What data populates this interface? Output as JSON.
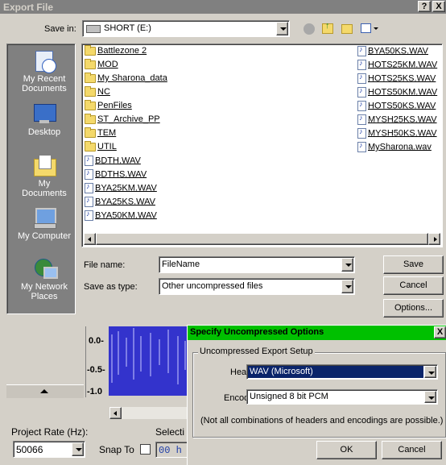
{
  "export_dialog": {
    "title": "Export File",
    "title_buttons": {
      "help": "?",
      "close": "X"
    },
    "save_in_label": "Save in:",
    "save_in_value": "SHORT (E:)",
    "places": [
      {
        "label": "My Recent Documents"
      },
      {
        "label": "Desktop"
      },
      {
        "label": "My Documents"
      },
      {
        "label": "My Computer"
      },
      {
        "label": "My Network Places"
      }
    ],
    "files_col1": [
      {
        "name": "Battlezone 2",
        "icon": "folder-icon"
      },
      {
        "name": "MOD",
        "icon": "folder-icon"
      },
      {
        "name": "My Sharona_data",
        "icon": "folder-icon"
      },
      {
        "name": "NC",
        "icon": "folder-icon"
      },
      {
        "name": "PenFiles",
        "icon": "folder-icon"
      },
      {
        "name": "ST_Archive_PP",
        "icon": "folder-icon"
      },
      {
        "name": "TEM",
        "icon": "folder-icon"
      },
      {
        "name": "UTIL",
        "icon": "folder-icon"
      },
      {
        "name": "BDTH.WAV",
        "icon": "wav-file-icon"
      },
      {
        "name": "BDTHS.WAV",
        "icon": "wav-file-icon"
      },
      {
        "name": "BYA25KM.WAV",
        "icon": "wav-file-icon"
      },
      {
        "name": "BYA25KS.WAV",
        "icon": "wav-file-icon"
      },
      {
        "name": "BYA50KM.WAV",
        "icon": "wav-file-icon"
      }
    ],
    "files_col2": [
      {
        "name": "BYA50KS.WAV",
        "icon": "wav-file-icon"
      },
      {
        "name": "HOTS25KM.WAV",
        "icon": "wav-file-icon"
      },
      {
        "name": "HOTS25KS.WAV",
        "icon": "wav-file-icon"
      },
      {
        "name": "HOTS50KM.WAV",
        "icon": "wav-file-icon"
      },
      {
        "name": "HOTS50KS.WAV",
        "icon": "wav-file-icon"
      },
      {
        "name": "MYSH25KS.WAV",
        "icon": "wav-file-icon"
      },
      {
        "name": "MYSH50KS.WAV",
        "icon": "wav-file-icon"
      },
      {
        "name": "MySharona.wav",
        "icon": "wav-file-icon"
      }
    ],
    "file_name_label": "File name:",
    "file_name_value": "FileName",
    "save_as_type_label": "Save as type:",
    "save_as_type_value": "Other uncompressed files",
    "save_button": "Save",
    "cancel_button": "Cancel",
    "options_button": "Options..."
  },
  "background": {
    "scale_labels": [
      "0.0-",
      "-0.5-",
      "-1.0"
    ],
    "project_rate_label": "Project Rate (Hz):",
    "project_rate_value": "50066",
    "snap_to_label": "Snap To",
    "selection_label": "Selecti",
    "time_value": "00 h"
  },
  "options_dialog": {
    "title": "Specify Uncompressed Options",
    "close": "X",
    "group_label": "Uncompressed Export Setup",
    "header_label": "Header:",
    "header_value": "WAV (Microsoft)",
    "encoding_label": "Encoding:",
    "encoding_value": "Unsigned 8 bit PCM",
    "note": "(Not all combinations of headers and encodings are possible.)",
    "ok_button": "OK",
    "cancel_button": "Cancel"
  },
  "colors": {
    "active_title": "#00c000",
    "inactive_title": "#808080",
    "places_bar": "#808080",
    "waveform": "#3333cc",
    "selection_highlight": "#0a246a"
  }
}
